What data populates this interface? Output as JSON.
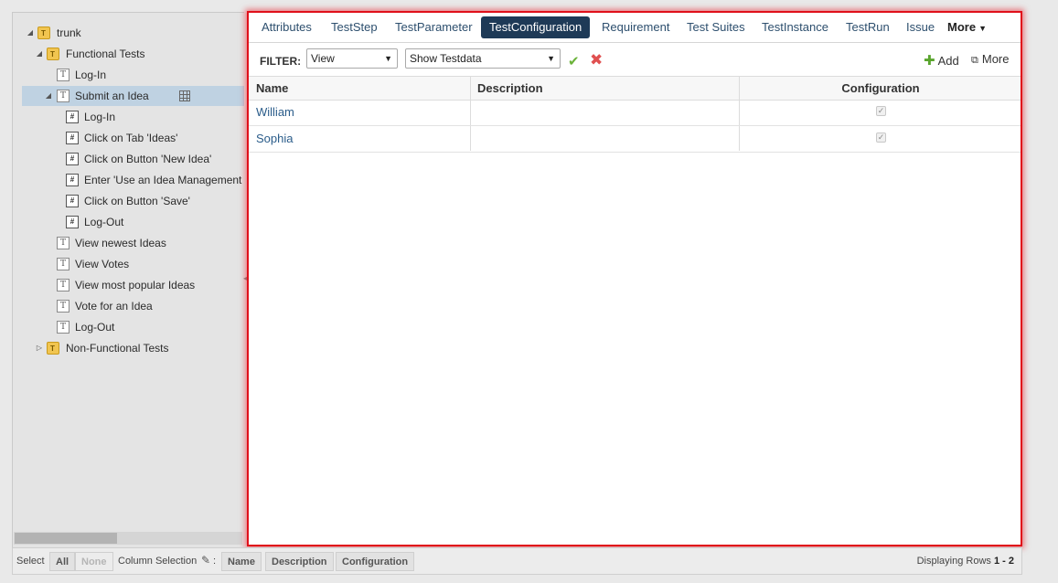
{
  "tree": {
    "nodes": [
      {
        "label": "trunk",
        "icon": "folder-icon",
        "twisty": "expanded"
      },
      {
        "label": "Functional Tests",
        "icon": "folder-icon",
        "twisty": "expanded"
      },
      {
        "label": "Log-In",
        "icon": "test-case-icon"
      },
      {
        "label": "Submit an Idea",
        "icon": "test-case-icon",
        "twisty": "expanded",
        "selected": true
      },
      {
        "label": "Log-In",
        "icon": "test-step-icon"
      },
      {
        "label": "Click on Tab 'Ideas'",
        "icon": "test-step-icon"
      },
      {
        "label": "Click on Button 'New Idea'",
        "icon": "test-step-icon"
      },
      {
        "label": "Enter 'Use an Idea Management Tool'",
        "icon": "test-step-icon"
      },
      {
        "label": "Click on Button 'Save'",
        "icon": "test-step-icon"
      },
      {
        "label": "Log-Out",
        "icon": "test-step-icon"
      },
      {
        "label": "View newest Ideas",
        "icon": "test-case-icon"
      },
      {
        "label": "View Votes",
        "icon": "test-case-icon"
      },
      {
        "label": "View most popular Ideas",
        "icon": "test-case-icon"
      },
      {
        "label": "Vote for an Idea",
        "icon": "test-case-icon"
      },
      {
        "label": "Log-Out",
        "icon": "test-case-icon"
      },
      {
        "label": "Non-Functional Tests",
        "icon": "folder-icon",
        "twisty": "collapsed"
      }
    ]
  },
  "tabs": [
    {
      "label": "Attributes"
    },
    {
      "label": "TestStep"
    },
    {
      "label": "TestParameter"
    },
    {
      "label": "TestConfiguration",
      "active": true
    },
    {
      "label": "Requirement"
    },
    {
      "label": "Test Suites"
    },
    {
      "label": "TestInstance"
    },
    {
      "label": "TestRun"
    },
    {
      "label": "Issue"
    },
    {
      "label": "More"
    }
  ],
  "filter": {
    "label": "FILTER:",
    "view_value": "View",
    "testdata_value": "Show Testdata",
    "add_label": "Add",
    "more_label": "More"
  },
  "grid": {
    "columns": [
      "Name",
      "Description",
      "Configuration"
    ],
    "rows": [
      {
        "name": "William",
        "description": "",
        "configuration": true
      },
      {
        "name": "Sophia",
        "description": "",
        "configuration": true
      }
    ]
  },
  "footer": {
    "select_label": "Select",
    "all_label": "All",
    "none_label": "None",
    "column_selection_label": "Column Selection",
    "colon": ":",
    "column_buttons": [
      "Name",
      "Description",
      "Configuration"
    ],
    "displaying_label": "Displaying Rows",
    "displaying_range": "1 - 2"
  },
  "colors": {
    "active_tab": "#1e3a57",
    "highlight_border": "#e0101a",
    "link": "#2a5c8a",
    "selected_tree_row": "#bfd2e2"
  }
}
